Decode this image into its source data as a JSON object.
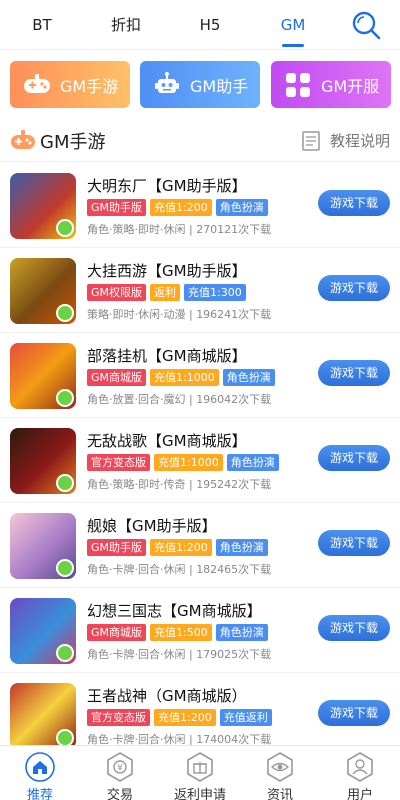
{
  "top_tabs": [
    {
      "label": "BT"
    },
    {
      "label": "折扣"
    },
    {
      "label": "H5"
    },
    {
      "label": "GM",
      "active": true
    }
  ],
  "search_icon": "search-icon",
  "categories": [
    {
      "label": "GM手游",
      "icon": "gamepad-icon",
      "color": "#ff9c5e"
    },
    {
      "label": "GM助手",
      "icon": "robot-icon",
      "color": "#5a9cf6"
    },
    {
      "label": "GM开服",
      "icon": "grid-icon",
      "color": "#cc5ff3"
    }
  ],
  "section": {
    "title": "GM手游",
    "title_icon": "gamepad-icon",
    "help_label": "教程说明",
    "help_icon": "document-icon"
  },
  "download_label": "游戏下载",
  "games": [
    {
      "name": "大明东厂【GM助手版】",
      "tags": [
        {
          "text": "GM助手版",
          "color": "#f0465a"
        },
        {
          "text": "充值1:200",
          "color": "#ffaa1e"
        },
        {
          "text": "角色扮演",
          "color": "#4a8ff0"
        }
      ],
      "meta": "角色·策略·即时·休闲 | 270121次下载"
    },
    {
      "name": "大挂西游【GM助手版】",
      "tags": [
        {
          "text": "GM权限版",
          "color": "#f0465a"
        },
        {
          "text": "返利",
          "color": "#ffaa1e"
        },
        {
          "text": "充值1:300",
          "color": "#4a8ff0"
        }
      ],
      "meta": "策略·即时·休闲·动漫 | 196241次下载"
    },
    {
      "name": "部落挂机【GM商城版】",
      "tags": [
        {
          "text": "GM商城版",
          "color": "#f0465a"
        },
        {
          "text": "充值1:1000",
          "color": "#ffaa1e"
        },
        {
          "text": "角色扮演",
          "color": "#4a8ff0"
        }
      ],
      "meta": "角色·放置·回合·魔幻 | 196042次下载"
    },
    {
      "name": "无敌战歌【GM商城版】",
      "tags": [
        {
          "text": "官方变态版",
          "color": "#f0465a"
        },
        {
          "text": "充值1:1000",
          "color": "#ffaa1e"
        },
        {
          "text": "角色扮演",
          "color": "#4a8ff0"
        }
      ],
      "meta": "角色·策略·即时·传奇 | 195242次下载"
    },
    {
      "name": "舰娘【GM助手版】",
      "tags": [
        {
          "text": "GM助手版",
          "color": "#f0465a"
        },
        {
          "text": "充值1:200",
          "color": "#ffaa1e"
        },
        {
          "text": "角色扮演",
          "color": "#4a8ff0"
        }
      ],
      "meta": "角色·卡牌·回合·休闲 | 182465次下载"
    },
    {
      "name": "幻想三国志【GM商城版】",
      "tags": [
        {
          "text": "GM商城版",
          "color": "#f0465a"
        },
        {
          "text": "充值1:500",
          "color": "#ffaa1e"
        },
        {
          "text": "角色扮演",
          "color": "#4a8ff0"
        }
      ],
      "meta": "角色·卡牌·回合·休闲 | 179025次下载"
    },
    {
      "name": "王者战神（GM商城版）",
      "tags": [
        {
          "text": "官方变态版",
          "color": "#f0465a"
        },
        {
          "text": "充值1:200",
          "color": "#ffaa1e"
        },
        {
          "text": "充值返利",
          "color": "#4a8ff0"
        }
      ],
      "meta": "角色·卡牌·回合·休闲 | 174004次下载"
    }
  ],
  "bottom_nav": [
    {
      "label": "推荐",
      "icon": "home-icon",
      "active": true
    },
    {
      "label": "交易",
      "icon": "exchange-icon"
    },
    {
      "label": "返利申请",
      "icon": "gift-icon"
    },
    {
      "label": "资讯",
      "icon": "eye-icon"
    },
    {
      "label": "用户",
      "icon": "user-icon"
    }
  ],
  "colors": {
    "accent": "#1f6fe0",
    "download": "#3a7fe6"
  }
}
